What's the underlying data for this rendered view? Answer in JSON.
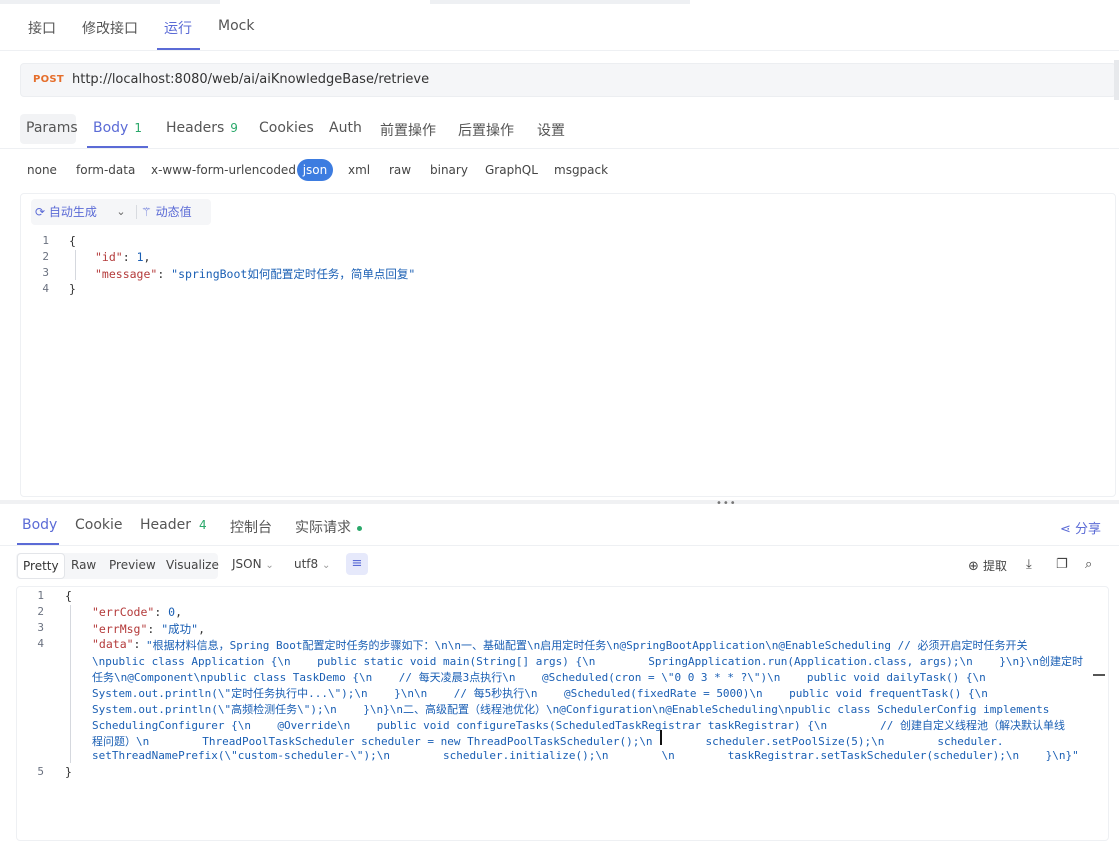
{
  "top_tabs": [
    "接口",
    "修改接口",
    "运行",
    "Mock"
  ],
  "request": {
    "method": "POST",
    "url": "http://localhost:8080/web/ai/aiKnowledgeBase/retrieve"
  },
  "request_tabs": {
    "params": "Params",
    "body": "Body",
    "body_count": "1",
    "headers": "Headers",
    "headers_count": "9",
    "cookies": "Cookies",
    "auth": "Auth",
    "pre": "前置操作",
    "post": "后置操作",
    "settings": "设置"
  },
  "body_types": [
    "none",
    "form-data",
    "x-www-form-urlencoded",
    "json",
    "xml",
    "raw",
    "binary",
    "GraphQL",
    "msgpack"
  ],
  "editor_toolbar": {
    "auto_generate": "自动生成",
    "dynamic_value": "动态值"
  },
  "request_body": {
    "line_numbers": [
      "1",
      "2",
      "3",
      "4"
    ],
    "open": "{",
    "key_id": "\"id\"",
    "val_id": "1",
    "key_message": "\"message\"",
    "val_message": "\"springBoot如何配置定时任务，简单点回复\"",
    "close": "}"
  },
  "response_tabs": {
    "body": "Body",
    "cookie": "Cookie",
    "header": "Header",
    "header_count": "4",
    "console": "控制台",
    "actual_request": "实际请求",
    "share": "分享"
  },
  "view_modes": [
    "Pretty",
    "Raw",
    "Preview",
    "Visualize"
  ],
  "format_select": "JSON",
  "encoding_select": "utf8",
  "response_actions": {
    "extract": "提取"
  },
  "response_body": {
    "line_numbers": [
      "1",
      "2",
      "3",
      "4",
      "5"
    ],
    "open": "{",
    "key_errCode": "\"errCode\"",
    "val_errCode": "0",
    "key_errMsg": "\"errMsg\"",
    "val_errMsg": "\"成功\"",
    "key_data": "\"data\"",
    "data_lines": [
      "\"根据材料信息，Spring Boot配置定时任务的步骤如下：\\n\\n一、基础配置\\n启用定时任务\\n@SpringBootApplication\\n@EnableScheduling // 必须开启定时任务开关",
      "\\npublic class Application {\\n    public static void main(String[] args) {\\n        SpringApplication.run(Application.class, args);\\n    }\\n}\\n创建定时",
      "任务\\n@Component\\npublic class TaskDemo {\\n    // 每天凌晨3点执行\\n    @Scheduled(cron = \\\"0 0 3 * * ?\\\")\\n    public void dailyTask() {\\n",
      "System.out.println(\\\"定时任务执行中...\\\");\\n    }\\n\\n    // 每5秒执行\\n    @Scheduled(fixedRate = 5000)\\n    public void frequentTask() {\\n",
      "System.out.println(\\\"高频检测任务\\\");\\n    }\\n}\\n二、高级配置（线程池优化）\\n@Configuration\\n@EnableScheduling\\npublic class SchedulerConfig implements",
      "SchedulingConfigurer {\\n    @Override\\n    public void configureTasks(ScheduledTaskRegistrar taskRegistrar) {\\n        // 创建自定义线程池（解决默认单线",
      "程问题）\\n        ThreadPoolTaskScheduler scheduler = new ThreadPoolTaskScheduler();\\n        scheduler.setPoolSize(5);\\n        scheduler.",
      "setThreadNamePrefix(\\\"custom-scheduler-\\\");\\n        scheduler.initialize();\\n        \\n        taskRegistrar.setTaskScheduler(scheduler);\\n    }\\n}\""
    ],
    "close": "}"
  },
  "colors": {
    "accent": "#5b6bd6",
    "method_post": "#e56e2b",
    "json_key": "#b43b3b",
    "json_value": "#1a5fb4",
    "success_green": "#2aa86a",
    "json_pill": "#3d7ce0"
  }
}
